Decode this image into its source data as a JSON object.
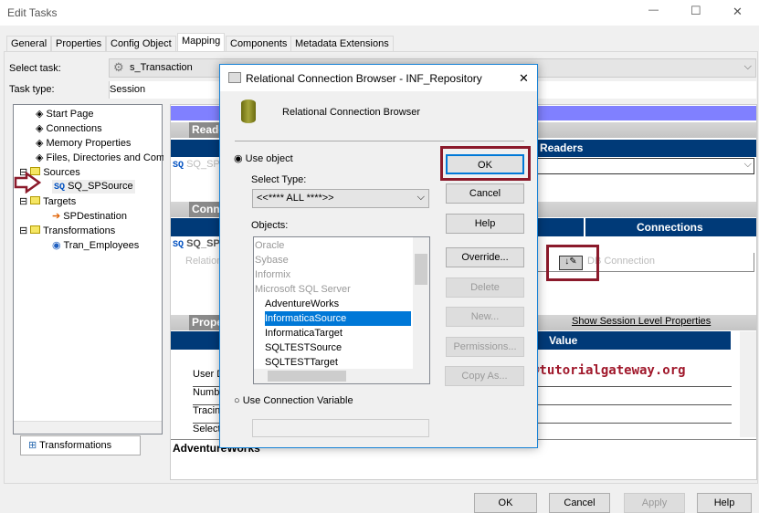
{
  "window": {
    "title": "Edit Tasks",
    "min": "—",
    "max": "☐",
    "close": "✕"
  },
  "tabs": [
    "General",
    "Properties",
    "Config Object",
    "Mapping",
    "Components",
    "Metadata Extensions"
  ],
  "select_task": {
    "label": "Select task:",
    "value": "s_Transaction"
  },
  "task_type": {
    "label": "Task type:",
    "value": "Session"
  },
  "tree": {
    "items": [
      "Start Page",
      "Connections",
      "Memory Properties",
      "Files, Directories and Commands",
      "Sources",
      "SQ_SPSource",
      "Targets",
      "SPDestination",
      "Transformations",
      "Tran_Employees"
    ],
    "sq": "SQ"
  },
  "bottom_tab": "Transformations",
  "right": {
    "readers_section": "Readers",
    "readers_header": "Readers",
    "reader_row": "SQ_SPSource",
    "connections_section": "Connections",
    "connections_header": "Connections",
    "conn_row": "SQ_SPSource",
    "relational": "Relational",
    "db_connection": "DB Connection",
    "properties_section": "Properties",
    "show_session": "Show Session Level Properties",
    "value_header": "Value",
    "prop_rows": [
      "User Defined",
      "Number",
      "Tracing",
      "Select"
    ],
    "desc": "AdventureWorks"
  },
  "dialog": {
    "title": "Relational Connection Browser - INF_Repository",
    "heading": "Relational Connection Browser",
    "use_object": "Use object",
    "select_type_label": "Select Type:",
    "select_type_value": "<<**** ALL ****>>",
    "objects_label": "Objects:",
    "objects": [
      "Oracle",
      "Sybase",
      "Informix",
      "Microsoft SQL Server",
      "AdventureWorks",
      "InformaticaSource",
      "InformaticaTarget",
      "SQLTESTSource",
      "SQLTESTTarget"
    ],
    "selected": "InformaticaSource",
    "use_conn_var": "Use Connection Variable",
    "buttons": [
      "OK",
      "Cancel",
      "Help",
      "Override...",
      "Delete",
      "New...",
      "Permissions...",
      "Copy As..."
    ]
  },
  "watermark": "©tutorialgateway.org",
  "footer": [
    "OK",
    "Cancel",
    "Apply",
    "Help"
  ],
  "colors": {
    "highlight": "#8b1a2b",
    "header": "#003a78",
    "selection": "#0078d7"
  }
}
